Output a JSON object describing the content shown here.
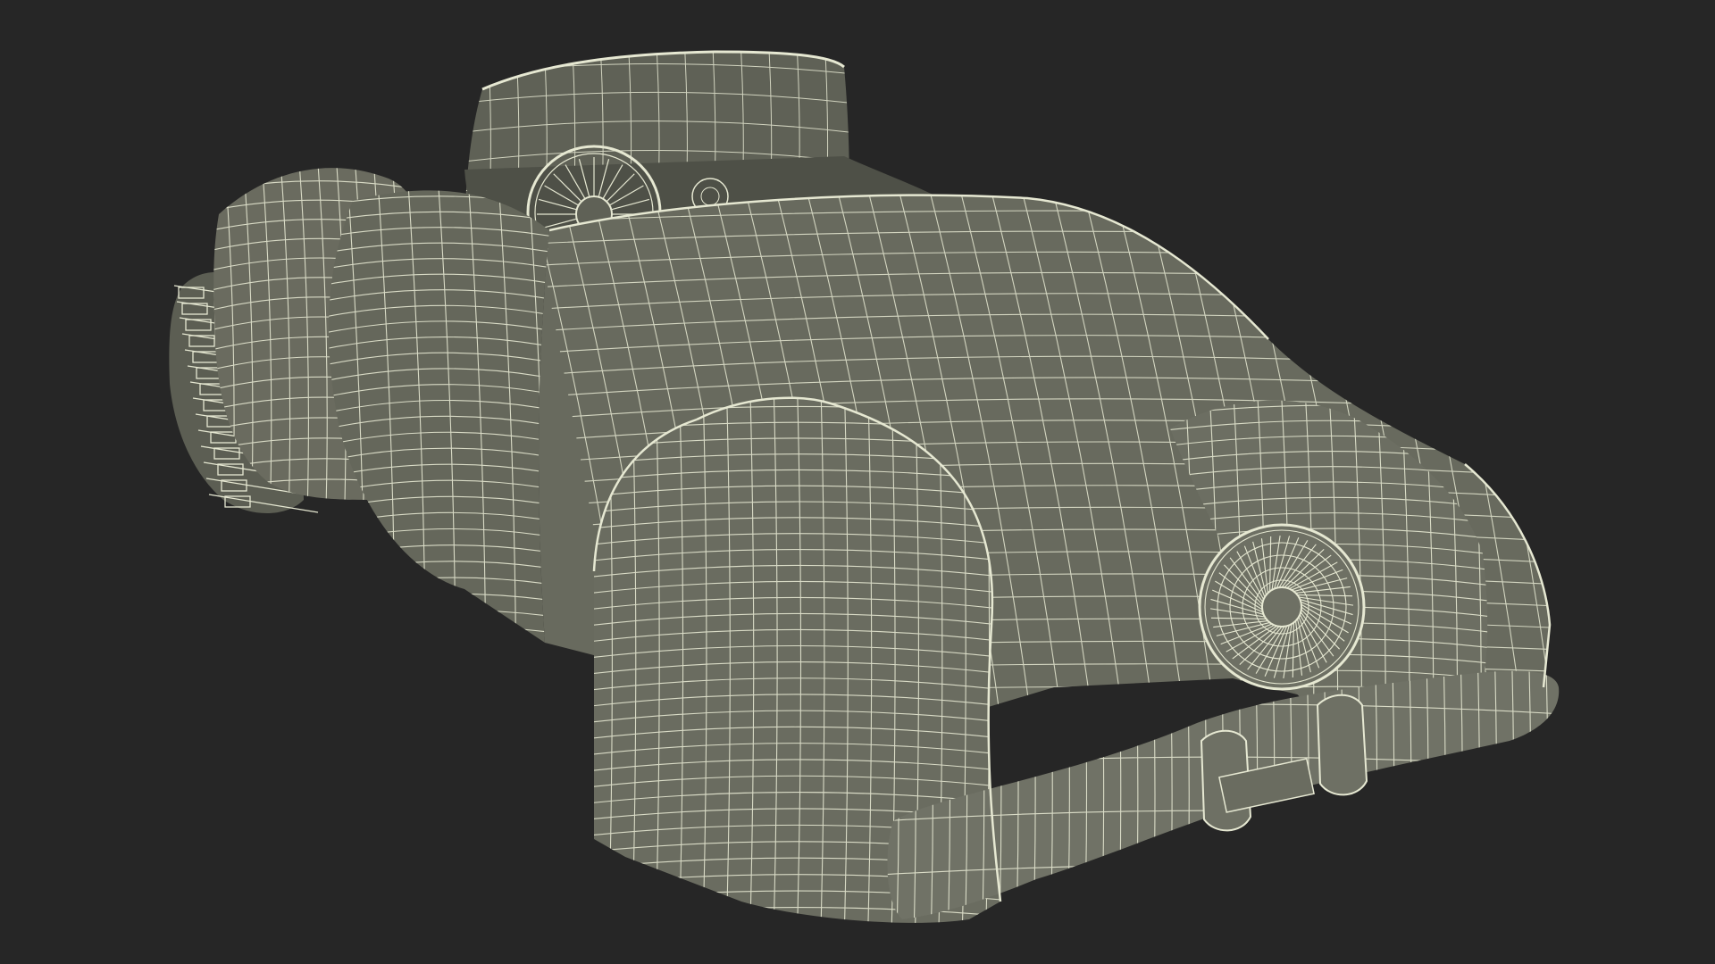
{
  "scene": {
    "subject_icon": "wireframe-convertible-car-icon",
    "colors": {
      "background": "#262626",
      "surface": "#6b6c60",
      "surface_dark": "#585a4f",
      "surface_light": "#7a7b6e",
      "wire": "#e6e8d2",
      "interior": "#55574d"
    }
  }
}
